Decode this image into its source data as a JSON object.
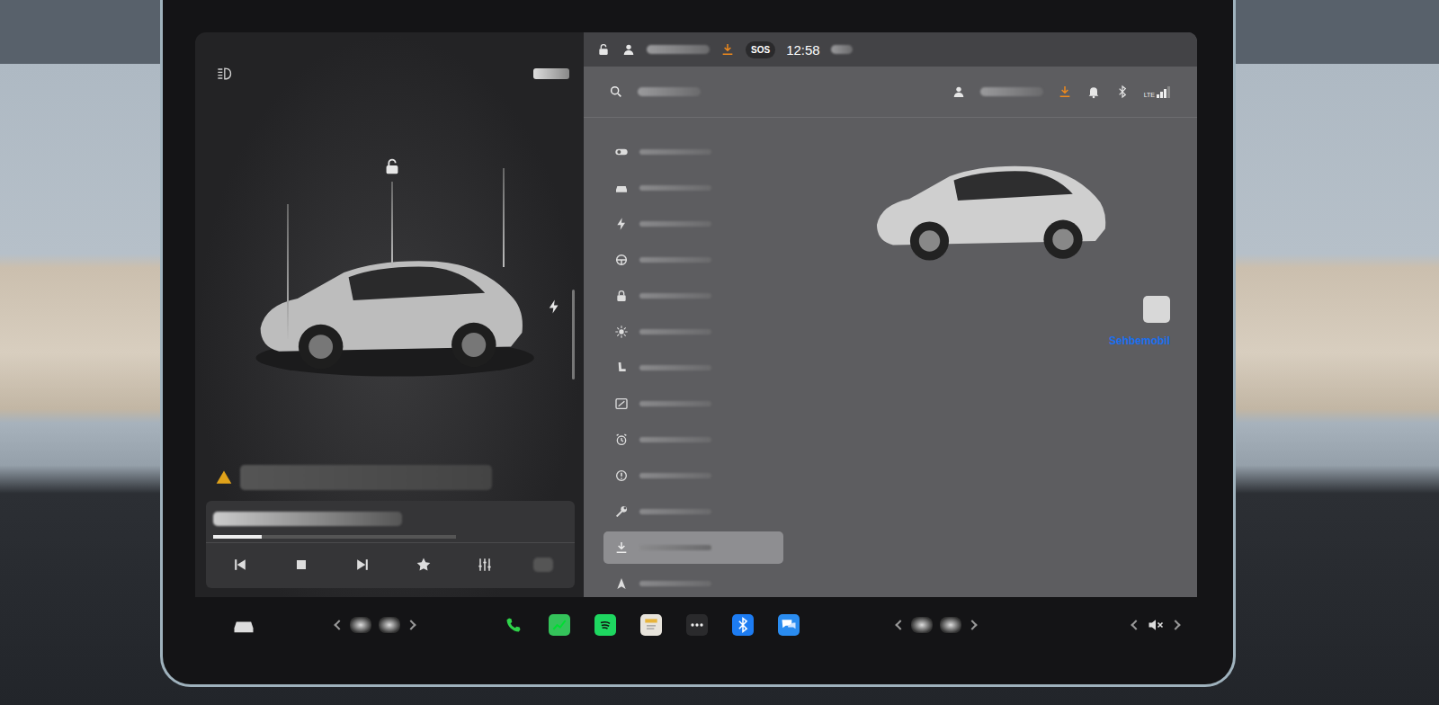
{
  "status_bar": {
    "time": "12:58",
    "sos": "SOS",
    "locked": false,
    "download_pending": true
  },
  "header": {
    "network": "LTE",
    "signal_level": 0.75,
    "download_pending": true,
    "bluetooth_on": true
  },
  "left_panel": {
    "locked": false,
    "charging": true,
    "alert": true
  },
  "media": {
    "playing": true,
    "progress": 0.2,
    "controls": [
      {
        "kind": "previous"
      },
      {
        "kind": "stop"
      },
      {
        "kind": "next"
      },
      {
        "kind": "favorite"
      },
      {
        "kind": "equalizer"
      }
    ]
  },
  "settings": {
    "items": [
      {
        "kind": "toggle",
        "selected": false
      },
      {
        "kind": "car",
        "selected": false
      },
      {
        "kind": "charge",
        "selected": false
      },
      {
        "kind": "wheel",
        "selected": false
      },
      {
        "kind": "lock",
        "selected": false
      },
      {
        "kind": "light",
        "selected": false
      },
      {
        "kind": "seat",
        "selected": false
      },
      {
        "kind": "display",
        "selected": false
      },
      {
        "kind": "alarm",
        "selected": false
      },
      {
        "kind": "alert",
        "selected": false
      },
      {
        "kind": "service",
        "selected": false
      },
      {
        "kind": "software",
        "selected": true
      },
      {
        "kind": "navigate",
        "selected": false
      }
    ]
  },
  "detail": {
    "link": "Sehbemobil",
    "toggle_on": false
  },
  "taskbar": {
    "muted": true,
    "apps": [
      {
        "kind": "phone",
        "color": "#2fd34a"
      },
      {
        "kind": "energy",
        "color": "#34c35a"
      },
      {
        "kind": "spotify",
        "color": "#1ed760"
      },
      {
        "kind": "notes",
        "color": "#e8e4dc"
      },
      {
        "kind": "more",
        "color": "#2a2a2c"
      },
      {
        "kind": "bluetooth",
        "color": "#1d7cf2"
      },
      {
        "kind": "messages",
        "color": "#2a8cf0"
      }
    ]
  }
}
